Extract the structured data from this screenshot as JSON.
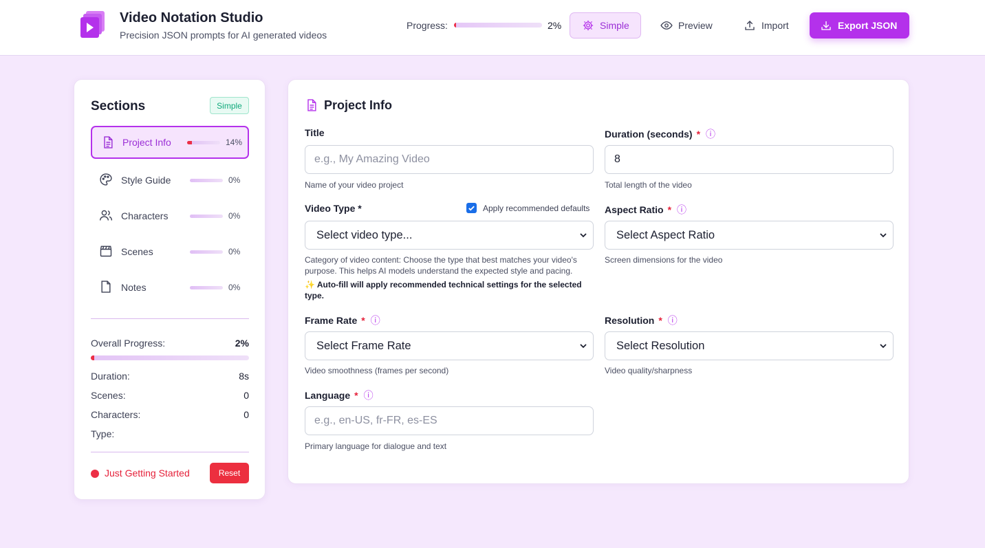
{
  "header": {
    "title": "Video Notation Studio",
    "subtitle": "Precision JSON prompts for AI generated videos",
    "progress_label": "Progress:",
    "progress_value": "2%",
    "progress_fraction": 0.02,
    "buttons": {
      "simple": "Simple",
      "preview": "Preview",
      "import": "Import",
      "export": "Export JSON"
    }
  },
  "sidebar": {
    "title": "Sections",
    "mode_badge": "Simple",
    "items": [
      {
        "label": "Project Info",
        "pct": "14%",
        "fraction": 0.14,
        "icon": "document-icon",
        "active": true
      },
      {
        "label": "Style Guide",
        "pct": "0%",
        "fraction": 0,
        "icon": "palette-icon",
        "active": false
      },
      {
        "label": "Characters",
        "pct": "0%",
        "fraction": 0,
        "icon": "users-icon",
        "active": false
      },
      {
        "label": "Scenes",
        "pct": "0%",
        "fraction": 0,
        "icon": "clapperboard-icon",
        "active": false
      },
      {
        "label": "Notes",
        "pct": "0%",
        "fraction": 0,
        "icon": "file-icon",
        "active": false
      }
    ],
    "overall_label": "Overall Progress:",
    "overall_value": "2%",
    "overall_fraction": 0.02,
    "stats": {
      "duration_label": "Duration:",
      "duration_value": "8s",
      "scenes_label": "Scenes:",
      "scenes_value": "0",
      "characters_label": "Characters:",
      "characters_value": "0",
      "type_label": "Type:",
      "type_value": ""
    },
    "status_text": "Just Getting Started",
    "reset_label": "Reset"
  },
  "main": {
    "title": "Project Info",
    "fields": {
      "title": {
        "label": "Title",
        "placeholder": "e.g., My Amazing Video",
        "helper": "Name of your video project"
      },
      "duration": {
        "label": "Duration (seconds)",
        "value": "8",
        "helper": "Total length of the video"
      },
      "video_type": {
        "label": "Video Type *",
        "selected": "Select video type...",
        "helper": "Category of video content: Choose the type that best matches your video's purpose. This helps AI models understand the expected style and pacing.",
        "autofill": "✨ Auto-fill will apply recommended technical settings for the selected type.",
        "checkbox_label": "Apply recommended defaults",
        "checkbox_checked": true
      },
      "aspect_ratio": {
        "label": "Aspect Ratio",
        "selected": "Select Aspect Ratio",
        "helper": "Screen dimensions for the video"
      },
      "frame_rate": {
        "label": "Frame Rate",
        "selected": "Select Frame Rate",
        "helper": "Video smoothness (frames per second)"
      },
      "resolution": {
        "label": "Resolution",
        "selected": "Select Resolution",
        "helper": "Video quality/sharpness"
      },
      "language": {
        "label": "Language",
        "placeholder": "e.g., en-US, fr-FR, es-ES",
        "helper": "Primary language for dialogue and text"
      }
    },
    "required_mark": "*",
    "info_mark": "ⓘ"
  },
  "colors": {
    "accent": "#b431eb",
    "background": "#f5e8fd",
    "danger": "#ec2f46",
    "badge_green": "#10a97b"
  }
}
